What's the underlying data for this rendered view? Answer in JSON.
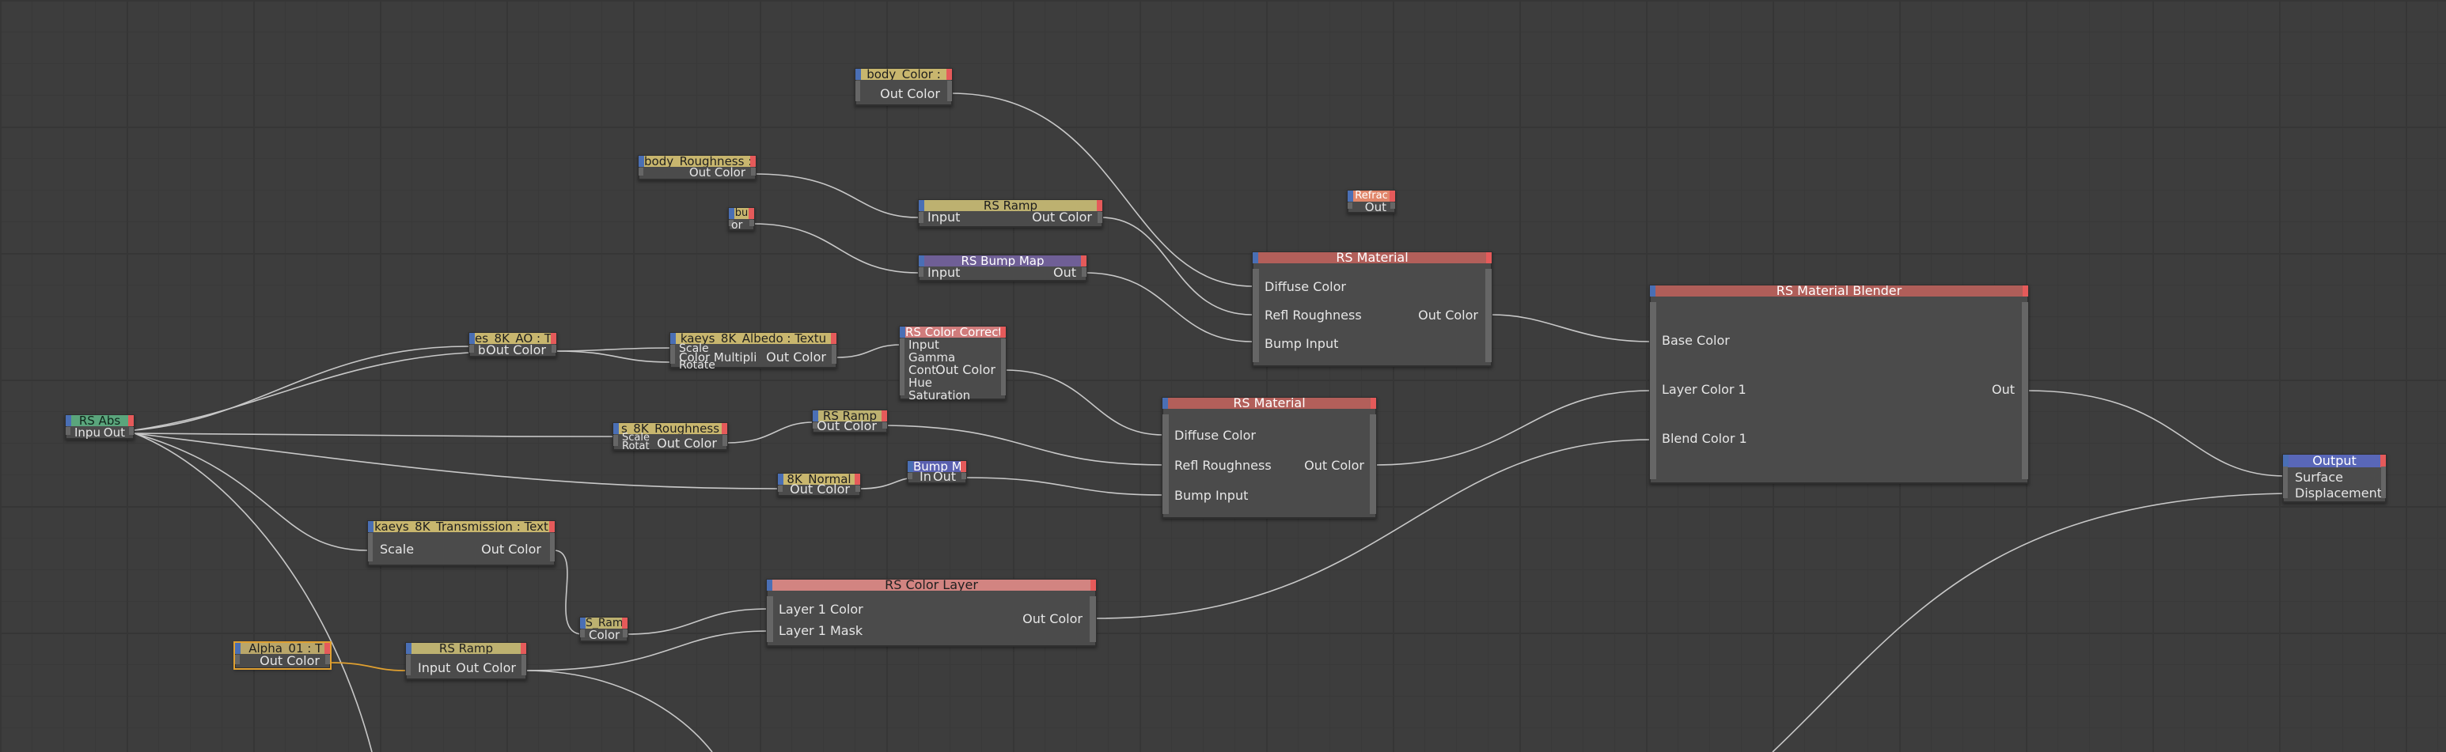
{
  "nodes": {
    "body_color": {
      "title": "body_Color :",
      "out": "Out Color"
    },
    "body_roughness": {
      "title": "body_Roughness :",
      "out": "Out Color"
    },
    "bu_small": {
      "title": "bu",
      "out": "or"
    },
    "ramp_top": {
      "title": "RS Ramp",
      "in": "Input",
      "out": "Out Color"
    },
    "bump_map": {
      "title": "RS Bump Map",
      "in": "Input",
      "out": "Out"
    },
    "refrac": {
      "title": "Refrac",
      "out": "Out"
    },
    "material_1": {
      "title": "RS Material",
      "p1": "Diffuse Color",
      "p2": "Refl Roughness",
      "p3": "Bump Input",
      "out": "Out Color"
    },
    "blender": {
      "title": "RS Material Blender",
      "p1": "Base Color",
      "p2": "Layer Color 1",
      "p3": "Blend Color 1",
      "out": "Out"
    },
    "ao": {
      "title": "es_8K_AO : T",
      "a": "b",
      "out": "Out Color"
    },
    "albedo": {
      "title": "kaeys_8K_Albedo : Textu",
      "a": "Scale",
      "b": "Color Multipli",
      "c": "Rotate",
      "out": "Out Color"
    },
    "color_correct": {
      "title": "RS Color Correct",
      "a": "Input",
      "b": "Gamma",
      "c": "Cont",
      "d": "Hue",
      "e": "Saturation",
      "out": "Out Color"
    },
    "abs": {
      "title": "RS Abs",
      "in": "Inpu",
      "out": "Out"
    },
    "roughness_8k": {
      "title": "s_8K_Roughness",
      "a": "Scale",
      "b": "Rotat",
      "out": "Out Color"
    },
    "ramp_mid": {
      "title": "RS Ramp",
      "out": "Out Color"
    },
    "material_2": {
      "title": "RS Material",
      "p1": "Diffuse Color",
      "p2": "Refl Roughness",
      "p3": "Bump Input",
      "out": "Out Color"
    },
    "normal_8k": {
      "title": "8K_Normal",
      "out": "Out Color"
    },
    "bump_small": {
      "title": "Bump M",
      "in": "In",
      "out": "Out"
    },
    "output": {
      "title": "Output",
      "p1": "Surface",
      "p2": "Displacement"
    },
    "transmission": {
      "title": "kaeys_8K_Transmission : Text",
      "a": "Scale",
      "out": "Out Color"
    },
    "ramp_small": {
      "title": "S_Ram",
      "in": "Color"
    },
    "color_layer": {
      "title": "RS Color Layer",
      "p1": "Layer 1 Color",
      "p2": "Layer 1 Mask",
      "out": "Out Color"
    },
    "alpha": {
      "title": "_Alpha_01 : T",
      "out": "Out Color"
    },
    "ramp_bottom": {
      "title": "RS Ramp",
      "in": "Input",
      "out": "Out Color"
    }
  },
  "colors": {
    "wire": "#c8c8c8",
    "wire_selected": "#e0a030",
    "port_in": "#4a6fb5",
    "port_out": "#e55a5a"
  }
}
